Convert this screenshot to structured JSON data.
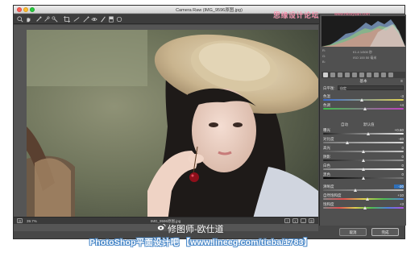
{
  "window": {
    "title": "Camera Raw (IMG_9596原图.jpg)"
  },
  "toolbar": {
    "tools": [
      "zoom-icon",
      "hand-icon",
      "white-balance-icon",
      "color-sampler-icon",
      "targeted-adjustment-icon",
      "crop-icon",
      "straighten-icon",
      "spot-removal-icon",
      "red-eye-icon",
      "adjustment-brush-icon",
      "graduated-filter-icon",
      "radial-filter-icon"
    ]
  },
  "histogram": {
    "readout_left_1": "R:",
    "readout_left_2": "G:",
    "readout_left_3": "B:",
    "readout_right_1": "f/1.4  1/500 秒",
    "readout_right_2": "ISO 100  50 毫米"
  },
  "panel": {
    "title": "基本",
    "white_balance_label": "白平衡:",
    "white_balance_value": "自定",
    "auto_label": "自动",
    "default_label": "默认值",
    "sliders": [
      {
        "label": "色温",
        "value": "-3"
      },
      {
        "label": "色调",
        "value": "+4"
      },
      {
        "label": "曝光",
        "value": "+0.60"
      },
      {
        "label": "对比度",
        "value": "-40"
      },
      {
        "label": "高光",
        "value": "0"
      },
      {
        "label": "阴影",
        "value": "0"
      },
      {
        "label": "白色",
        "value": "0"
      },
      {
        "label": "黑色",
        "value": "0"
      },
      {
        "label": "清晰度",
        "value": "-20"
      },
      {
        "label": "自然饱和度",
        "value": "+10"
      },
      {
        "label": "饱和度",
        "value": "+3"
      }
    ]
  },
  "statusbar": {
    "zoom": "39.7%",
    "filename": "IMG_9596原图.jpg"
  },
  "buttons": {
    "cancel": "取消",
    "done": "完成"
  },
  "watermarks": {
    "top_site": "思缘设计论坛",
    "top_url": "www.missyuan.com",
    "author": "修图师-欧仕道",
    "bottom": "PhotoShop平面设计吧 【www.lineeg.com/tieba/1783】"
  },
  "colors": {
    "window_bg": "#474747",
    "panel_bg": "#505050",
    "highlight": "#2f6fb8",
    "watermark_pink": "#ff7a9e"
  }
}
